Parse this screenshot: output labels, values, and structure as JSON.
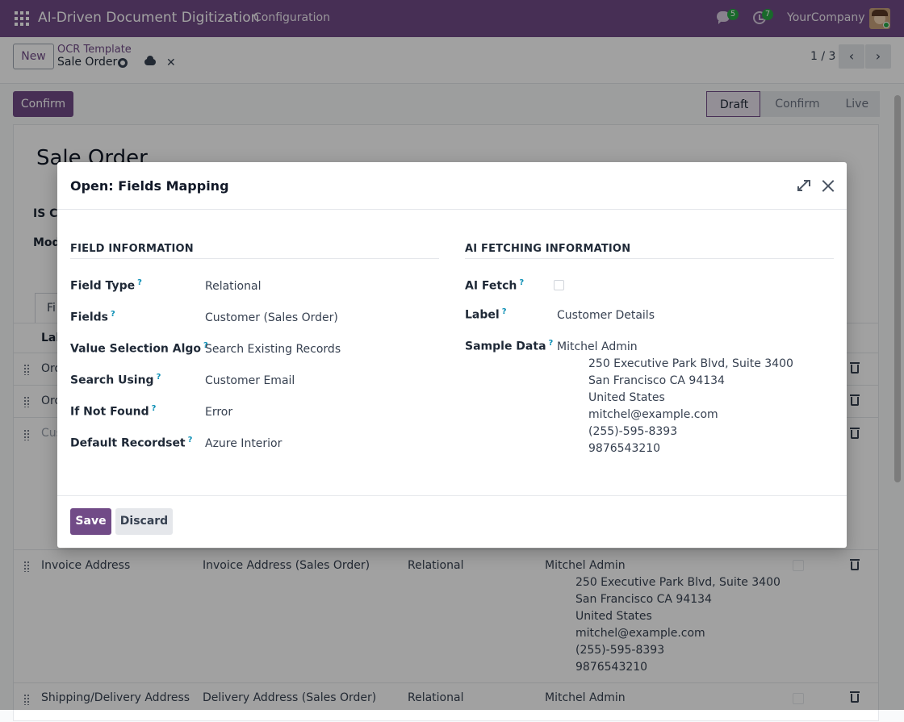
{
  "navbar": {
    "app_title": "AI-Driven Document Digitization",
    "menu_item": "Configuration",
    "messages_count": "5",
    "activities_count": "7",
    "company": "YourCompany"
  },
  "control_panel": {
    "new_label": "New",
    "breadcrumb_parent": "OCR Template",
    "breadcrumb_current": "Sale Order",
    "pager": "1 / 3"
  },
  "status": {
    "confirm_label": "Confirm",
    "stages": [
      "Draft",
      "Confirm",
      "Live"
    ],
    "active_stage": "Draft"
  },
  "form": {
    "title": "Sale Order",
    "label_is_check": "IS Ch",
    "label_model": "Mod",
    "tab_label": "Fi",
    "col_label": "Lab",
    "rows": [
      {
        "label": "Ord"
      },
      {
        "label": "Ord"
      },
      {
        "label": "Cus"
      },
      {
        "label": "Invoice Address",
        "field": "Invoice Address (Sales Order)",
        "type": "Relational",
        "sample_name": "Mitchel Admin",
        "sample_lines": [
          "250 Executive Park Blvd, Suite 3400",
          "San Francisco CA 94134",
          "United States",
          "mitchel@example.com",
          "(255)-595-8393",
          "9876543210"
        ]
      },
      {
        "label": "Shipping/Delivery Address",
        "field": "Delivery Address (Sales Order)",
        "type": "Relational",
        "sample_name": "Mitchel Admin"
      }
    ]
  },
  "modal": {
    "title": "Open: Fields Mapping",
    "field_info_title": "FIELD INFORMATION",
    "ai_info_title": "AI FETCHING INFORMATION",
    "field_info": [
      {
        "label": "Field Type",
        "value": "Relational"
      },
      {
        "label": "Fields",
        "value": "Customer (Sales Order)"
      },
      {
        "label": "Value Selection Algo",
        "value": "Search Existing Records"
      },
      {
        "label": "Search Using",
        "value": "Customer Email"
      },
      {
        "label": "If Not Found",
        "value": "Error"
      },
      {
        "label": "Default Recordset",
        "value": "Azure Interior"
      }
    ],
    "ai_fetch_label": "AI Fetch",
    "ai_fetch_checked": false,
    "label_label": "Label",
    "label_value": "Customer Details",
    "sample_label": "Sample Data",
    "sample_name": "Mitchel Admin",
    "sample_lines": [
      "250 Executive Park Blvd, Suite 3400",
      "San Francisco CA 94134",
      "United States",
      "mitchel@example.com",
      "(255)-595-8393",
      "9876543210"
    ],
    "help_marker": "?",
    "save_label": "Save",
    "discard_label": "Discard"
  },
  "colors": {
    "brand": "#714b87",
    "badge": "#28a745",
    "help": "#0d8fb5"
  }
}
